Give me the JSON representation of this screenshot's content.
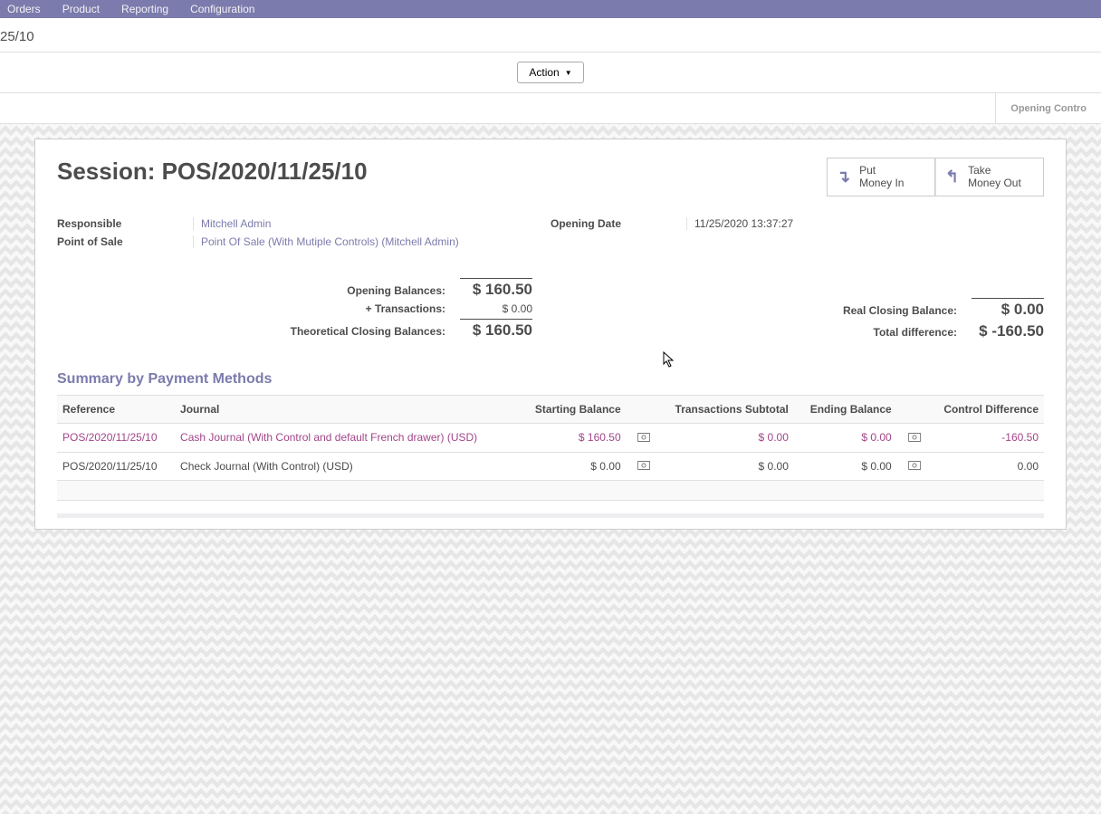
{
  "nav": {
    "items": [
      "Orders",
      "Product",
      "Reporting",
      "Configuration"
    ]
  },
  "breadcrumb": "25/10",
  "action_button": "Action",
  "status_stage": "Opening Contro",
  "session": {
    "title": "Session: POS/2020/11/25/10",
    "put_money_in_line1": "Put",
    "put_money_in_line2": "Money In",
    "take_money_out_line1": "Take",
    "take_money_out_line2": "Money Out",
    "responsible_label": "Responsible",
    "responsible_value": "Mitchell Admin",
    "pos_label": "Point of Sale",
    "pos_value": "Point Of Sale (With Mutiple Controls) (Mitchell Admin)",
    "opening_date_label": "Opening Date",
    "opening_date_value": "11/25/2020 13:37:27"
  },
  "balances_left": {
    "opening_label": "Opening Balances:",
    "opening_value": "$ 160.50",
    "transactions_label": "+ Transactions:",
    "transactions_value": "$ 0.00",
    "theoretical_label": "Theoretical Closing Balances:",
    "theoretical_value": "$ 160.50"
  },
  "balances_right": {
    "real_label": "Real Closing Balance:",
    "real_value": "$ 0.00",
    "diff_label": "Total difference:",
    "diff_value": "$ -160.50"
  },
  "summary": {
    "title": "Summary by Payment Methods",
    "columns": {
      "reference": "Reference",
      "journal": "Journal",
      "starting": "Starting Balance",
      "transactions": "Transactions Subtotal",
      "ending": "Ending Balance",
      "control": "Control Difference"
    },
    "rows": [
      {
        "reference": "POS/2020/11/25/10",
        "journal": "Cash Journal (With Control and default French drawer) (USD)",
        "starting": "$ 160.50",
        "transactions": "$ 0.00",
        "ending": "$ 0.00",
        "control": "-160.50",
        "highlight": true
      },
      {
        "reference": "POS/2020/11/25/10",
        "journal": "Check Journal (With Control) (USD)",
        "starting": "$ 0.00",
        "transactions": "$ 0.00",
        "ending": "$ 0.00",
        "control": "0.00",
        "highlight": false
      }
    ]
  }
}
